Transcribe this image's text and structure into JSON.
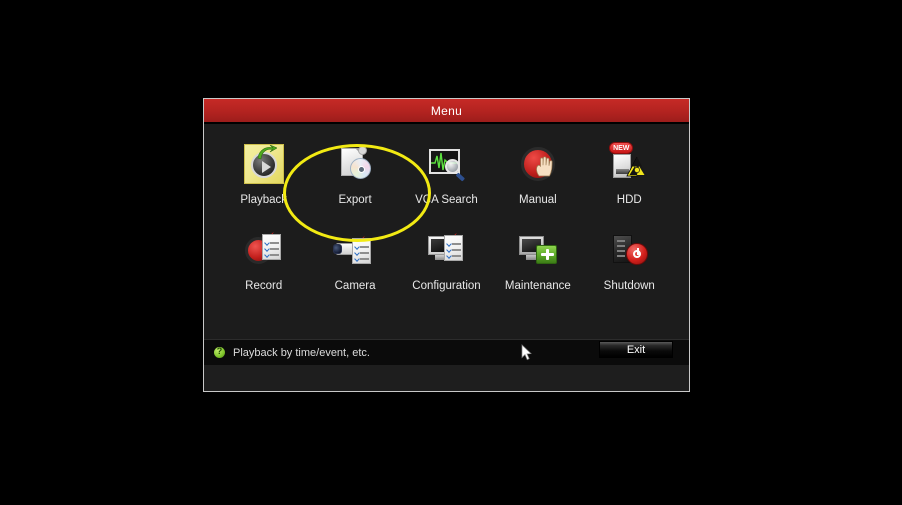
{
  "window": {
    "title": "Menu"
  },
  "menu": {
    "row1": [
      {
        "label": "Playback",
        "icon": "playback-icon"
      },
      {
        "label": "Export",
        "icon": "export-icon"
      },
      {
        "label": "VCA Search",
        "icon": "vca-search-icon"
      },
      {
        "label": "Manual",
        "icon": "manual-icon"
      },
      {
        "label": "HDD",
        "icon": "hdd-icon",
        "badge": "NEW"
      }
    ],
    "row2": [
      {
        "label": "Record",
        "icon": "record-icon"
      },
      {
        "label": "Camera",
        "icon": "camera-icon"
      },
      {
        "label": "Configuration",
        "icon": "configuration-icon"
      },
      {
        "label": "Maintenance",
        "icon": "maintenance-icon"
      },
      {
        "label": "Shutdown",
        "icon": "shutdown-icon"
      }
    ]
  },
  "status_bar": {
    "help_icon": "help-question-icon",
    "hint_text": "Playback by time/event, etc.",
    "exit_label": "Exit"
  },
  "annotation": {
    "highlight_target": "Export",
    "highlight_shape": "ellipse",
    "highlight_color": "#f2ea13"
  },
  "colors": {
    "title_bar": "#b32320",
    "window_background": "#1c1c1c",
    "desktop_background": "#000000",
    "label_text": "#e8e8e8",
    "highlight": "#f2ea13"
  }
}
